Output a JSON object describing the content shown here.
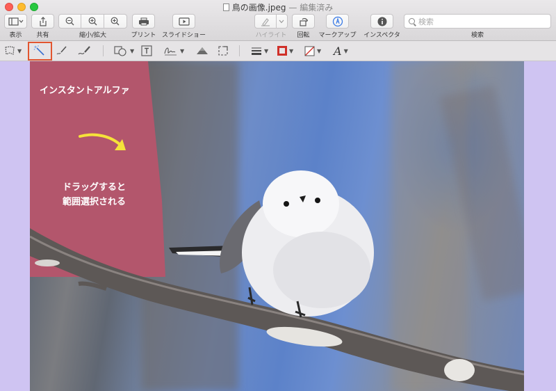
{
  "window": {
    "title": "鳥の画像.jpeg",
    "edited_suffix": "— 編集済み"
  },
  "toolbar": {
    "view_label": "表示",
    "share_label": "共有",
    "zoom_label": "縮小/拡大",
    "print_label": "プリント",
    "slideshow_label": "スライドショー",
    "highlight_label": "ハイライト",
    "rotate_label": "回転",
    "markup_label": "マークアップ",
    "inspector_label": "インスペクタ",
    "search_label": "検索",
    "search_placeholder": "検索"
  },
  "markup": {
    "tools": [
      "selection-tools",
      "instant-alpha",
      "sketch",
      "draw",
      "shapes",
      "text",
      "sign",
      "adjust-color",
      "adjust-size",
      "shape-style",
      "border-color",
      "fill-color",
      "text-style"
    ],
    "text_style_glyph": "A",
    "border_color": "#d0302a",
    "highlighted_tool": "instant-alpha",
    "highlight_color": "#e2552f"
  },
  "image": {
    "overlay_title": "インスタントアルファ",
    "overlay_line1": "ドラッグすると",
    "overlay_line2": "範囲選択される",
    "selection_color": "#b3566c",
    "arrow_color": "#f5e23a"
  },
  "colors": {
    "window_bg": "#cfc4f2",
    "sky": "#6d8cc8"
  }
}
